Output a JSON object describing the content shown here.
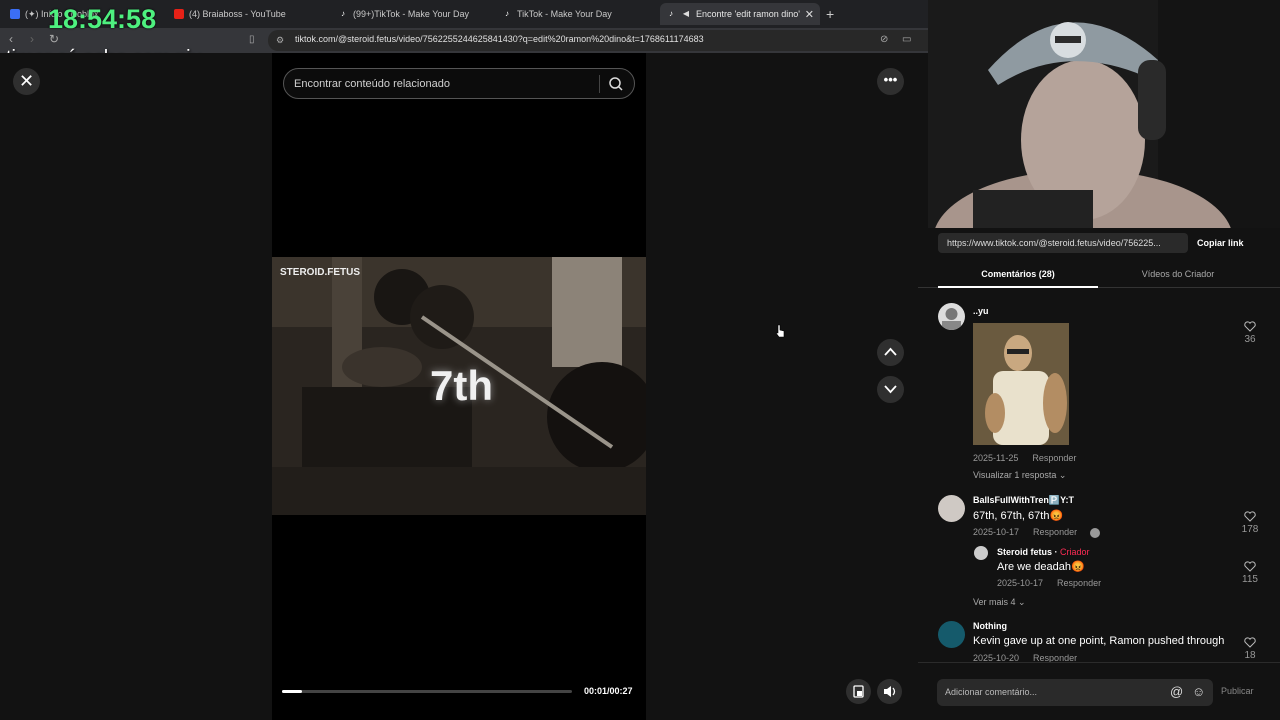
{
  "overlay": {
    "clock": "18:54:58",
    "timer_text": "timer só sobe com pix"
  },
  "browser": {
    "tabs": [
      {
        "label": "(✦) Início - Roblox"
      },
      {
        "label": "(4) Braiaboss - YouTube"
      },
      {
        "label": "(99+)TikTok - Make Your Day"
      },
      {
        "label": "TikTok - Make Your Day"
      },
      {
        "label": "Encontre 'edit ramon dino' no"
      }
    ],
    "tab_close": "✕",
    "new_tab": "+",
    "url": "tiktok.com/@steroid.fetus/video/7562255244625841430?q=edit%20ramon%20dino&t=1768611174683"
  },
  "video": {
    "search_placeholder": "Encontrar conteúdo relacionado",
    "watermark": "STEROID.FETUS",
    "overlay_text": "7th",
    "progress_fraction": 0.07,
    "timecode": "00:01/00:27"
  },
  "share": {
    "link": "https://www.tiktok.com/@steroid.fetus/video/756225...",
    "copy_label": "Copiar link"
  },
  "panel_tabs": {
    "comments": "Comentários (28)",
    "creator_videos": "Vídeos do Criador"
  },
  "comments": [
    {
      "user": "..yu",
      "text": "",
      "date": "2025-11-25",
      "reply_label": "Responder",
      "likes": "36",
      "view_replies": "Visualizar 1 resposta ⌄"
    },
    {
      "user": "BallsFullWithTren🅿️Y:T",
      "text": "67th, 67th, 67th😡",
      "date": "2025-10-17",
      "reply_label": "Responder",
      "likes": "178",
      "reply": {
        "user": "Steroid fetus",
        "creator_label": "Criador",
        "text": "Are we deadah😡",
        "date": "2025-10-17",
        "reply_label": "Responder",
        "likes": "115"
      },
      "more": "Ver mais 4 ⌄"
    },
    {
      "user": "Nothing",
      "text": "Kevin gave up at one point, Ramon pushed through",
      "date": "2025-10-20",
      "reply_label": "Responder",
      "likes": "18"
    }
  ],
  "composer": {
    "placeholder": "Adicionar comentário...",
    "at_icon": "@",
    "emoji_icon": "☺",
    "post_label": "Publicar"
  }
}
